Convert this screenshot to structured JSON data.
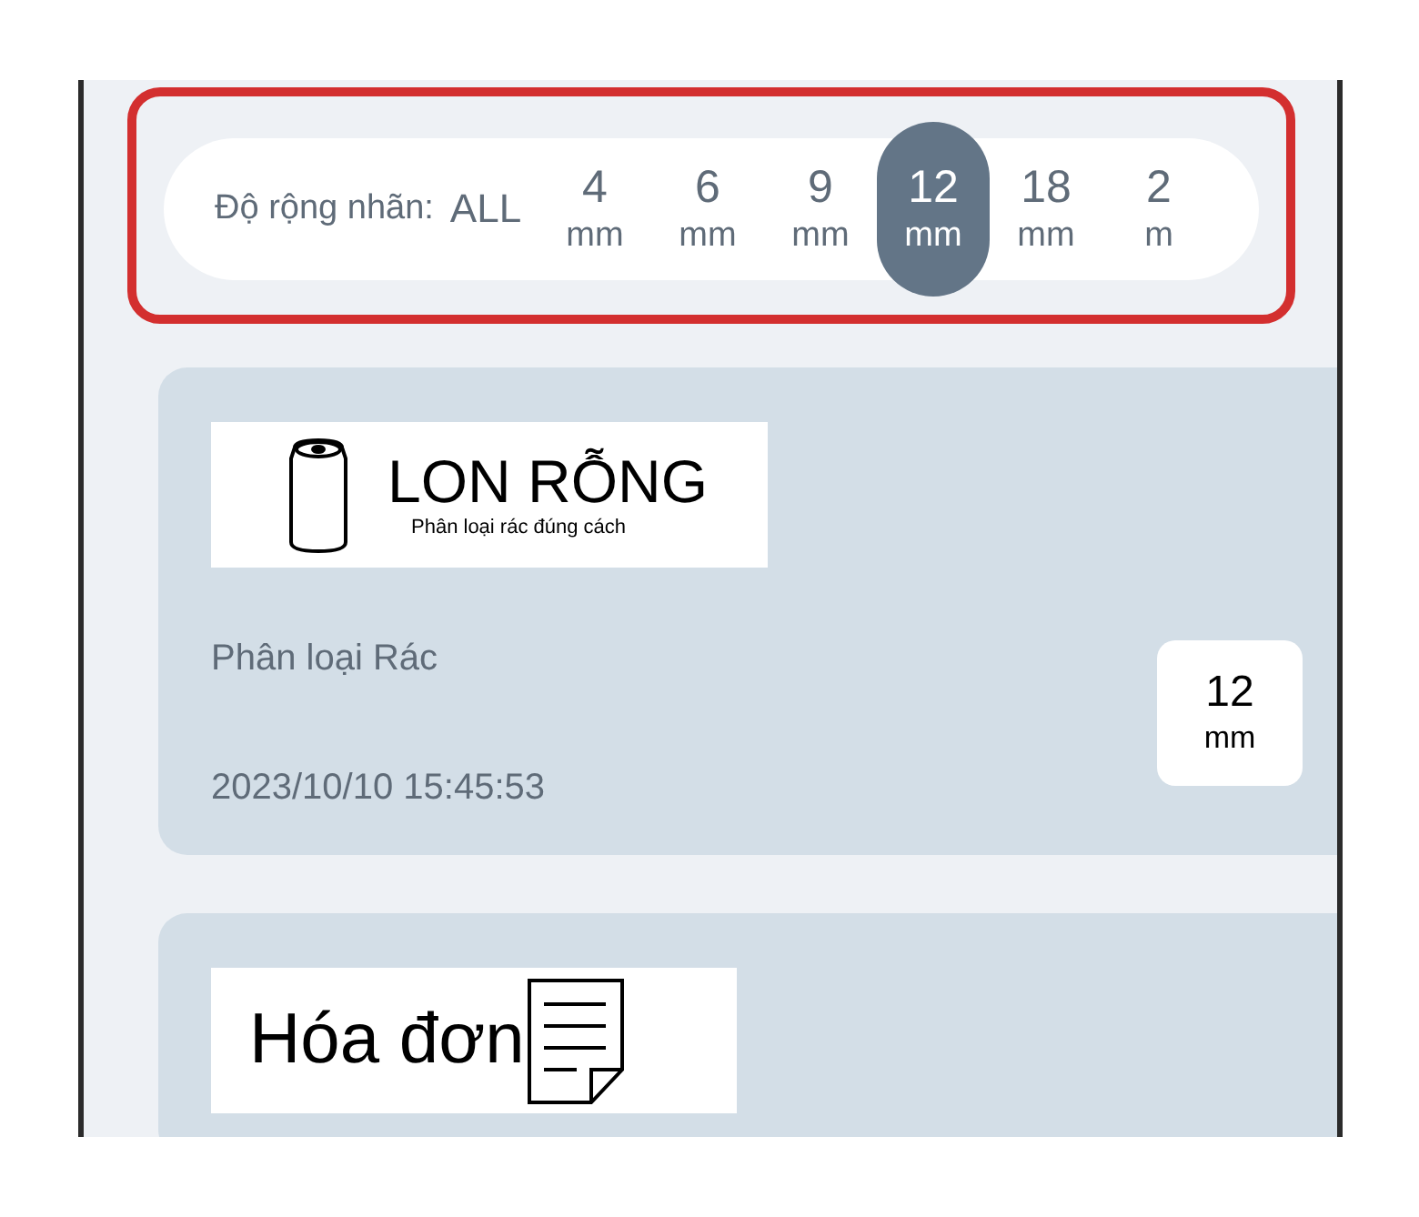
{
  "width_filter": {
    "label": "Độ rộng nhãn:",
    "highlighted": true,
    "options": [
      {
        "value": "ALL",
        "selected": false
      },
      {
        "value": "4",
        "unit": "mm",
        "selected": false
      },
      {
        "value": "6",
        "unit": "mm",
        "selected": false
      },
      {
        "value": "9",
        "unit": "mm",
        "selected": false
      },
      {
        "value": "12",
        "unit": "mm",
        "selected": true
      },
      {
        "value": "18",
        "unit": "mm",
        "selected": false
      },
      {
        "value": "2",
        "unit": "m",
        "selected": false
      }
    ]
  },
  "cards": [
    {
      "preview": {
        "kind": "can",
        "title": "LON RỖNG",
        "subtitle": "Phân loại rác đúng cách"
      },
      "name": "Phân loại Rác",
      "date": "2023/10/10 15:45:53",
      "width": {
        "value": "12",
        "unit": "mm"
      }
    },
    {
      "preview": {
        "kind": "receipt",
        "title": "Hóa đơn"
      }
    }
  ]
}
